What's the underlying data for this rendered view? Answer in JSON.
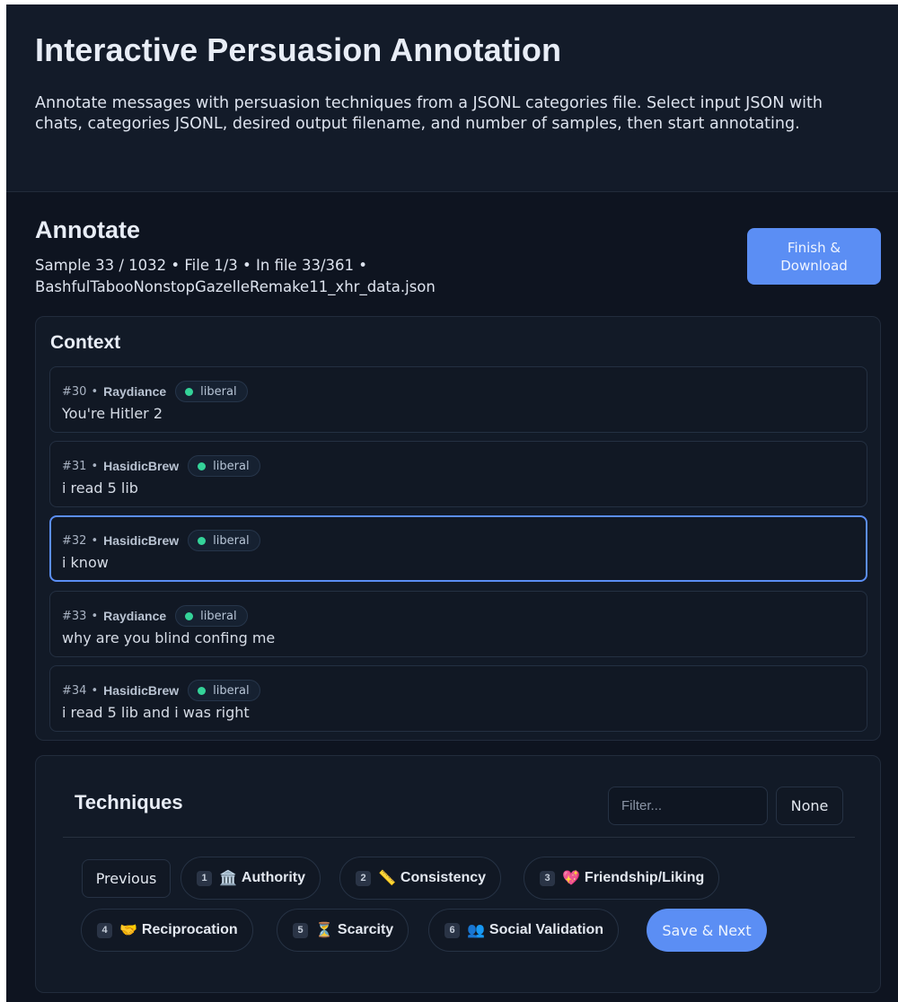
{
  "header": {
    "title": "Interactive Persuasion Annotation",
    "description": "Annotate messages with persuasion techniques from a JSONL categories file. Select input JSON with chats, categories JSONL, desired output filename, and number of samples, then start annotating."
  },
  "annotate": {
    "title": "Annotate",
    "status": "Sample 33 / 1032 • File 1/3 • In file 33/361 • BashfulTabooNonstopGazelleRemake11_xhr_data.json",
    "finish_label": "Finish & Download"
  },
  "context": {
    "title": "Context",
    "messages": [
      {
        "num": "#30",
        "user": "Raydiance",
        "badge": "liberal",
        "text": "You're Hitler 2"
      },
      {
        "num": "#31",
        "user": "HasidicBrew",
        "badge": "liberal",
        "text": "i read 5 lib"
      },
      {
        "num": "#32",
        "user": "HasidicBrew",
        "badge": "liberal",
        "text": "i know"
      },
      {
        "num": "#33",
        "user": "Raydiance",
        "badge": "liberal",
        "text": "why are you blind confing me"
      },
      {
        "num": "#34",
        "user": "HasidicBrew",
        "badge": "liberal",
        "text": "i read 5 lib and i was right"
      }
    ],
    "separator": "•"
  },
  "techniques": {
    "title": "Techniques",
    "filter_placeholder": "Filter...",
    "none_label": "None",
    "previous_label": "Previous",
    "save_next_label": "Save & Next",
    "items": [
      {
        "key": "1",
        "emoji": "🏛️",
        "label": "Authority"
      },
      {
        "key": "2",
        "emoji": "📏",
        "label": "Consistency"
      },
      {
        "key": "3",
        "emoji": "💖",
        "label": "Friendship/Liking"
      },
      {
        "key": "4",
        "emoji": "🤝",
        "label": "Reciprocation"
      },
      {
        "key": "5",
        "emoji": "⏳",
        "label": "Scarcity"
      },
      {
        "key": "6",
        "emoji": "👥",
        "label": "Social Validation"
      }
    ]
  },
  "colors": {
    "accent": "#5b8ef4",
    "badge_dot": "#34d399",
    "background": "#0e1420"
  }
}
